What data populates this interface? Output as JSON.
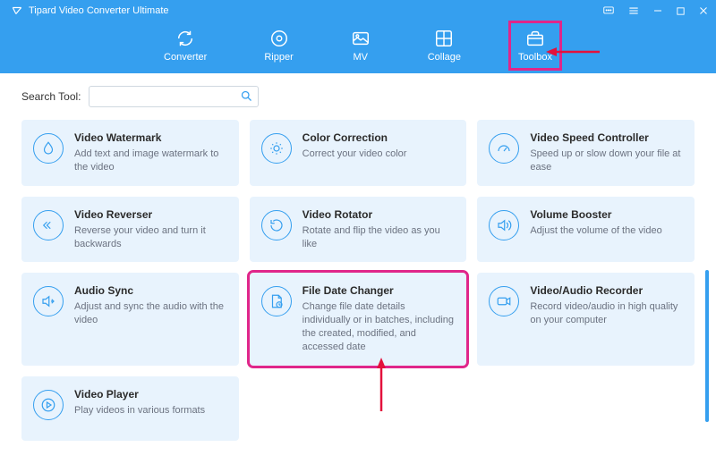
{
  "app": {
    "title": "Tipard Video Converter Ultimate"
  },
  "nav": {
    "converter": "Converter",
    "ripper": "Ripper",
    "mv": "MV",
    "collage": "Collage",
    "toolbox": "Toolbox"
  },
  "search": {
    "label": "Search Tool:",
    "value": ""
  },
  "tools": {
    "watermark": {
      "title": "Video Watermark",
      "desc": "Add text and image watermark to the video"
    },
    "color": {
      "title": "Color Correction",
      "desc": "Correct your video color"
    },
    "speed": {
      "title": "Video Speed Controller",
      "desc": "Speed up or slow down your file at ease"
    },
    "reverser": {
      "title": "Video Reverser",
      "desc": "Reverse your video and turn it backwards"
    },
    "rotator": {
      "title": "Video Rotator",
      "desc": "Rotate and flip the video as you like"
    },
    "volume": {
      "title": "Volume Booster",
      "desc": "Adjust the volume of the video"
    },
    "sync": {
      "title": "Audio Sync",
      "desc": "Adjust and sync the audio with the video"
    },
    "filedate": {
      "title": "File Date Changer",
      "desc": "Change file date details individually or in batches, including the created, modified, and accessed date"
    },
    "recorder": {
      "title": "Video/Audio Recorder",
      "desc": "Record video/audio in high quality on your computer"
    },
    "player": {
      "title": "Video Player",
      "desc": "Play videos in various formats"
    }
  },
  "colors": {
    "accent": "#359fef",
    "highlight": "#e0268a",
    "arrow": "#e3113c"
  }
}
